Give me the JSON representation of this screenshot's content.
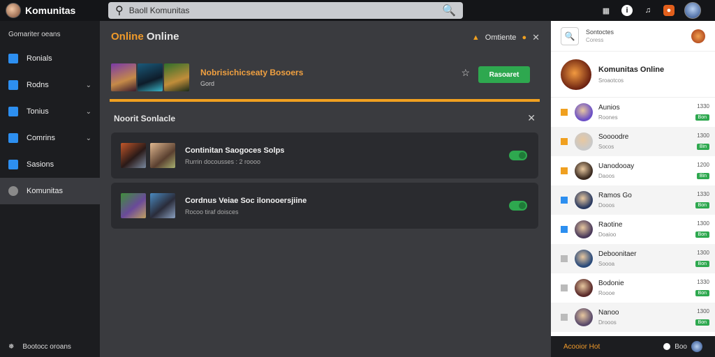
{
  "app": {
    "title": "Komunitas"
  },
  "search": {
    "placeholder": "Baoll Komunitas"
  },
  "topbar": {
    "icons": [
      "puzzle-icon",
      "info-icon",
      "music-icon",
      "notification-icon"
    ]
  },
  "sidebar": {
    "header": "Gomariter oeans",
    "items": [
      {
        "label": "Ronials",
        "icon": "chart-icon",
        "chevron": false
      },
      {
        "label": "Rodns",
        "icon": "check-icon",
        "chevron": true
      },
      {
        "label": "Tonius",
        "icon": "flag-icon",
        "chevron": true
      },
      {
        "label": "Comrins",
        "icon": "chat-icon",
        "chevron": true
      },
      {
        "label": "Sasions",
        "icon": "link-icon",
        "chevron": false
      },
      {
        "label": "Komunitas",
        "icon": "user-circle-icon",
        "chevron": false,
        "active": true
      }
    ],
    "footer": "Bootocc oroans"
  },
  "main": {
    "title_highlight": "Online",
    "title_rest": " Online",
    "header_right": "Omtiente",
    "feature": {
      "title": "Nobrisichicseaty Bosoers",
      "sub": "Gord",
      "button": "Rasoaret"
    },
    "section_title": "Noorit Sonlacle",
    "cards": [
      {
        "title": "Continitan Saogoces Solps",
        "sub": "Rurrin docousses : 2 roooo"
      },
      {
        "title": "Cordnus Veiae Soc ilonooersjiine",
        "sub": "Rocoo tiraf doisces"
      }
    ]
  },
  "right_panel": {
    "header_title": "Sontoctes",
    "header_sub": "Coress",
    "profile": {
      "name": "Komunitas Online",
      "status": "Sroaotcos"
    },
    "friends": [
      {
        "name": "Aunios",
        "sub": "Roones",
        "time": "1330",
        "badge": "Bon",
        "sq_color": "#f0a020",
        "av": "#6b4fc6"
      },
      {
        "name": "Soooodre",
        "sub": "Socos",
        "time": "1300",
        "badge": "Bin",
        "sq_color": "#f0a020",
        "av": "#c9c9c9"
      },
      {
        "name": "Uanodooay",
        "sub": "Daoos",
        "time": "1200",
        "badge": "Bin",
        "sq_color": "#f0a020",
        "av": "#3a2a20"
      },
      {
        "name": "Ramos Go",
        "sub": "Dooos",
        "time": "1330",
        "badge": "Bon",
        "sq_color": "#2d8ff0",
        "av": "#2a3a60"
      },
      {
        "name": "Raotine",
        "sub": "Doaioo",
        "time": "1300",
        "badge": "Bon",
        "sq_color": "#2d8ff0",
        "av": "#4a3a5a"
      },
      {
        "name": "Deboonitaer",
        "sub": "Soooa",
        "time": "1300",
        "badge": "Bon",
        "sq_color": "#bbbbbb",
        "av": "#2a4a7a"
      },
      {
        "name": "Bodonie",
        "sub": "Roooe",
        "time": "1330",
        "badge": "Bon",
        "sq_color": "#bbbbbb",
        "av": "#5a2a2a"
      },
      {
        "name": "Nanoo",
        "sub": "Drooos",
        "time": "1300",
        "badge": "Bon",
        "sq_color": "#bbbbbb",
        "av": "#5a4a6a"
      }
    ]
  },
  "right_footer": {
    "label": "Acooior Hot",
    "value": "Boo"
  }
}
